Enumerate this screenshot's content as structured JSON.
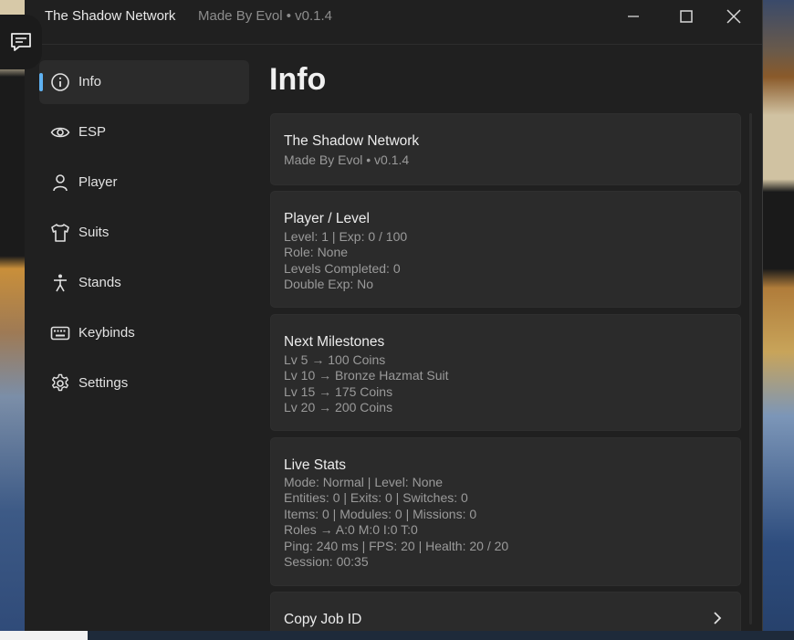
{
  "window": {
    "title": "The Shadow Network",
    "subtitle": "Made By Evol • v0.1.4",
    "controls": [
      "minimize-icon",
      "maximize-icon",
      "close-icon"
    ]
  },
  "sidebar": {
    "items": [
      {
        "label": "Info",
        "icon": "info-icon",
        "active": true
      },
      {
        "label": "ESP",
        "icon": "eye-icon"
      },
      {
        "label": "Player",
        "icon": "person-icon"
      },
      {
        "label": "Suits",
        "icon": "shirt-icon"
      },
      {
        "label": "Stands",
        "icon": "accessibility-icon"
      },
      {
        "label": "Keybinds",
        "icon": "keyboard-icon"
      },
      {
        "label": "Settings",
        "icon": "gear-icon"
      }
    ]
  },
  "main": {
    "page_title": "Info",
    "cards": [
      {
        "title": "The Shadow Network",
        "lines": [
          "Made By Evol • v0.1.4"
        ]
      },
      {
        "title": "Player / Level",
        "lines": [
          "Level: 1  |  Exp: 0 / 100",
          "Role: None",
          "Levels Completed: 0",
          "Double Exp: No"
        ]
      },
      {
        "title": "Next Milestones",
        "lines": [
          "Lv 5 → 100 Coins",
          "Lv 10 → Bronze Hazmat Suit",
          "Lv 15 → 175 Coins",
          "Lv 20 → 200 Coins"
        ]
      },
      {
        "title": "Live Stats",
        "lines": [
          "Mode: Normal | Level: None",
          "Entities: 0 | Exits: 0 | Switches: 0",
          "Items: 0 | Modules: 0 | Missions: 0",
          "Roles → A:0 M:0 I:0 T:0",
          "Ping: 240 ms | FPS: 20 | Health: 20 / 20",
          "Session: 00:35"
        ]
      },
      {
        "title": "Copy Job ID",
        "lines": []
      }
    ]
  },
  "colors": {
    "accent": "#5fb2f2",
    "window_bg": "#202020",
    "card_bg": "#2b2b2b",
    "muted_text": "#9a9a9a"
  }
}
